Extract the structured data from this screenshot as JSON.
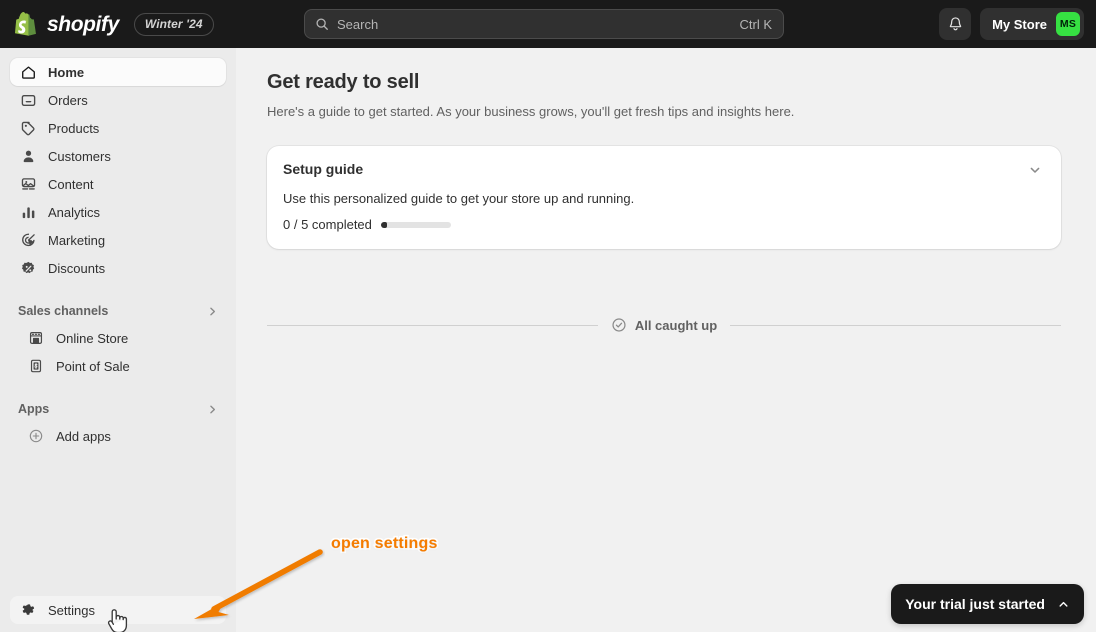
{
  "topbar": {
    "wordmark": "shopify",
    "version_badge": "Winter '24",
    "search": {
      "placeholder": "Search",
      "shortcut": "Ctrl K"
    },
    "notifications_icon": "bell-icon",
    "store_name": "My Store",
    "avatar_initials": "MS",
    "avatar_color": "#36e042",
    "background": "#1a1a1a"
  },
  "sidebar": {
    "background": "#ebebeb",
    "items": [
      {
        "label": "Home",
        "icon": "home-icon",
        "active": true
      },
      {
        "label": "Orders",
        "icon": "orders-inbox-icon",
        "active": false
      },
      {
        "label": "Products",
        "icon": "product-tag-icon",
        "active": false
      },
      {
        "label": "Customers",
        "icon": "person-icon",
        "active": false
      },
      {
        "label": "Content",
        "icon": "image-content-icon",
        "active": false
      },
      {
        "label": "Analytics",
        "icon": "bar-chart-icon",
        "active": false
      },
      {
        "label": "Marketing",
        "icon": "target-cursor-icon",
        "active": false
      },
      {
        "label": "Discounts",
        "icon": "discount-percent-badge-icon",
        "active": false
      }
    ],
    "sales_channels": {
      "title": "Sales channels",
      "chevron": "chevron-right-icon",
      "items": [
        {
          "label": "Online Store",
          "icon": "storefront-icon"
        },
        {
          "label": "Point of Sale",
          "icon": "pos-receipt-icon"
        }
      ]
    },
    "apps": {
      "title": "Apps",
      "chevron": "chevron-right-icon",
      "items": [
        {
          "label": "Add apps",
          "icon": "plus-circle-icon"
        }
      ]
    },
    "settings": {
      "label": "Settings",
      "icon": "gear-icon"
    }
  },
  "main": {
    "title": "Get ready to sell",
    "subtitle": "Here's a guide to get started. As your business grows, you'll get fresh tips and insights here.",
    "setup_card": {
      "title": "Setup guide",
      "description": "Use this personalized guide to get your store up and running.",
      "progress_label": "0 / 5 completed",
      "completed": 0,
      "total": 5,
      "collapse_icon": "chevron-down-icon"
    },
    "divider": {
      "label": "All caught up",
      "icon": "check-circle-icon"
    }
  },
  "annotation": {
    "text": "open settings",
    "color": "#f57c00",
    "arrow_icon": "arrow-pointer-icon",
    "cursor_icon": "pointing-hand-cursor-icon"
  },
  "trial_banner": {
    "text": "Your trial just started",
    "chevron": "chevron-up-icon",
    "background": "#1a1a1a"
  }
}
